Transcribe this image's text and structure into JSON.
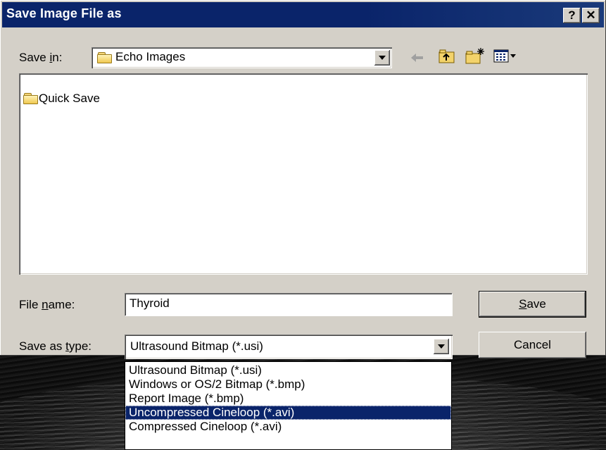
{
  "window": {
    "title": "Save Image File as",
    "help_label": "?",
    "close_label": "✕"
  },
  "save_in": {
    "label_pre": "Save ",
    "label_key": "i",
    "label_post": "n:",
    "value": "Echo Images"
  },
  "toolbar": {
    "back_icon": "back-arrow-icon",
    "up_icon": "up-folder-icon",
    "new_folder_icon": "new-folder-icon",
    "view_icon": "view-menu-icon"
  },
  "files": [
    {
      "name": "Quick Save",
      "icon": "folder-icon"
    }
  ],
  "file_name": {
    "label_pre": "File ",
    "label_key": "n",
    "label_post": "ame:",
    "value": "Thyroid"
  },
  "save_as_type": {
    "label_pre": "Save as ",
    "label_key": "t",
    "label_post": "ype:",
    "value": "Ultrasound Bitmap (*.usi)"
  },
  "buttons": {
    "save_key": "S",
    "save_rest": "ave",
    "cancel": "Cancel"
  },
  "type_options": [
    "Ultrasound Bitmap (*.usi)",
    "Windows or OS/2 Bitmap (*.bmp)",
    "Report Image (*.bmp)",
    "Uncompressed Cineloop (*.avi)",
    "Compressed Cineloop (*.avi)"
  ],
  "selected_option_index": 3,
  "colors": {
    "titlebar": "#0a246a",
    "face": "#d4d0c8",
    "selection": "#0a246a"
  }
}
